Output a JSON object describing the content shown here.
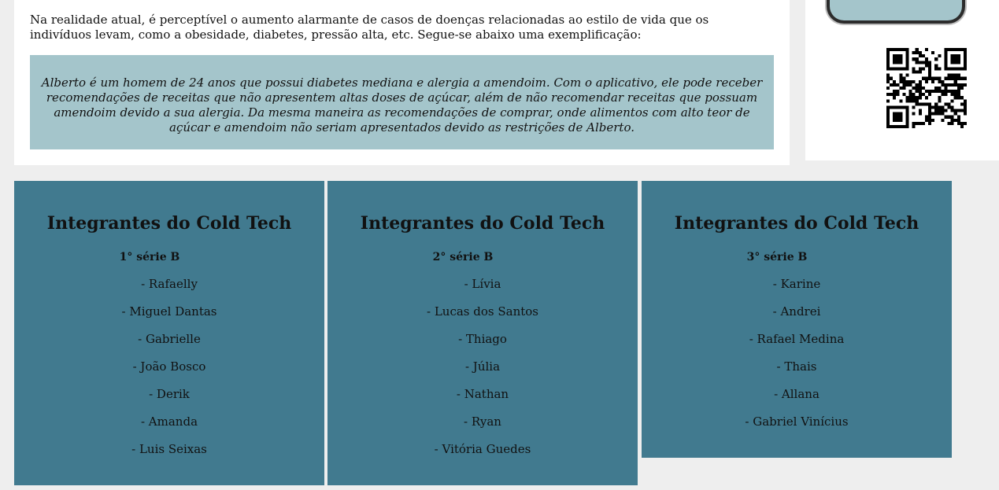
{
  "intro": {
    "paragraph": "Na realidade atual, é perceptível o aumento alarmante de casos de doenças relacionadas ao estilo de vida que os indivíduos levam, como a obesidade, diabetes, pressão alta, etc. Segue-se abaixo uma exemplificação:",
    "quote": "Alberto é um homem de 24 anos que possui diabetes mediana e alergia a amendoim. Com o aplicativo, ele pode receber recomendações de receitas que não apresentem altas doses de açúcar, além de não recomendar receitas que possuam amendoim devido a sua alergia. Da mesma maneira as recomendações de comprar, onde alimentos com alto teor de açúcar e amendoim não seriam apresentados devido as restrições de Alberto."
  },
  "groups": [
    {
      "title": "Integrantes do Cold Tech",
      "class_label": "1° série B",
      "members": [
        "- Rafaelly",
        "- Miguel Dantas",
        "- Gabrielle",
        "- João Bosco",
        "- Derik",
        "- Amanda",
        "- Luis Seixas"
      ]
    },
    {
      "title": "Integrantes do Cold Tech",
      "class_label": "2° série B",
      "members": [
        "- Lívia",
        "- Lucas dos Santos",
        "- Thiago",
        "- Júlia",
        "- Nathan",
        "- Ryan",
        "- Vitória Guedes"
      ]
    },
    {
      "title": "Integrantes do Cold Tech",
      "class_label": "3° série B",
      "members": [
        "- Karine",
        "- Andrei",
        "- Rafael Medina",
        "- Thais",
        "- Allana",
        "- Gabriel Vinícius"
      ]
    }
  ],
  "icons": {
    "phone": "phone-mockup-icon",
    "qr": "qr-code-icon"
  },
  "colors": {
    "page_background": "#eeeeee",
    "card_background": "#ffffff",
    "quote_background": "#a4c5cb",
    "members_background": "#417a8f"
  }
}
